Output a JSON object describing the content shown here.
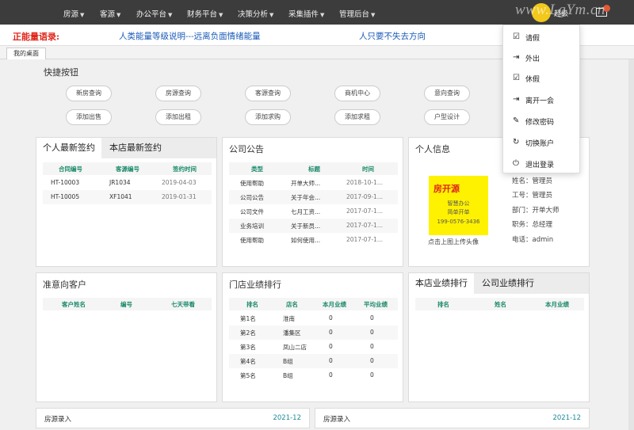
{
  "nav": {
    "items": [
      {
        "label": "房源"
      },
      {
        "label": "客源"
      },
      {
        "label": "办公平台"
      },
      {
        "label": "财务平台"
      },
      {
        "label": "决策分析"
      },
      {
        "label": "采集插件"
      },
      {
        "label": "管理后台"
      }
    ],
    "user_label": "超级",
    "watermark": "www.LgYm.cn"
  },
  "motto": {
    "label": "正能量语录:",
    "line1": "人类能量等级说明---远离负面情绪能量",
    "line2": "人只要不失去方向"
  },
  "tabs": {
    "home": "我的桌面"
  },
  "quick": {
    "title": "快捷按钮",
    "buttons": [
      "新房查询",
      "房源查询",
      "客源查询",
      "商机中心",
      "意向查询",
      "添加出售",
      "添加出租",
      "添加求购",
      "添加求租",
      "户型设计"
    ]
  },
  "sign": {
    "tabs": [
      "个人最新签约",
      "本店最新签约"
    ],
    "headers": [
      "合同编号",
      "客源编号",
      "签约时间"
    ],
    "rows": [
      [
        "HT-10003",
        "JR1034",
        "2019-04-03"
      ],
      [
        "HT-10005",
        "XF1041",
        "2019-01-31"
      ]
    ]
  },
  "notice": {
    "title": "公司公告",
    "headers": [
      "类型",
      "标题",
      "时间"
    ],
    "rows": [
      [
        "使用帮助",
        "开单大师...",
        "2018-10-1..."
      ],
      [
        "公司公告",
        "关于年会...",
        "2017-09-1..."
      ],
      [
        "公司文件",
        "七月工资...",
        "2017-07-1..."
      ],
      [
        "业务培训",
        "关于新员...",
        "2017-07-1..."
      ],
      [
        "使用帮助",
        "如何使用...",
        "2017-07-1..."
      ]
    ]
  },
  "profile": {
    "title": "个人信息",
    "logo": "房开源",
    "img_lines": [
      "智慧办公",
      "简单开单",
      "199-0576-3436"
    ],
    "caption": "点击上图上传头像",
    "lines": [
      "姓名：管理员",
      "工号：管理员",
      "部门：开单大师",
      "职务：总经理",
      "电话：admin"
    ]
  },
  "prospect": {
    "title": "准意向客户",
    "headers": [
      "客户姓名",
      "编号",
      "七天带看"
    ]
  },
  "shop_rank": {
    "title": "门店业绩排行",
    "headers": [
      "排名",
      "店名",
      "本月业绩",
      "平均业绩"
    ],
    "rows": [
      [
        "第1名",
        "淮南",
        "0",
        "0"
      ],
      [
        "第2名",
        "潘集区",
        "0",
        "0"
      ],
      [
        "第3名",
        "凤山二店",
        "0",
        "0"
      ],
      [
        "第4名",
        "B组",
        "0",
        "0"
      ],
      [
        "第5名",
        "B组",
        "0",
        "0"
      ]
    ]
  },
  "perf": {
    "tabs": [
      "本店业绩排行",
      "公司业绩排行"
    ],
    "headers": [
      "排名",
      "姓名",
      "本月业绩"
    ]
  },
  "bottom": [
    {
      "label": "房源录入",
      "date": "2021-12"
    },
    {
      "label": "房源录入",
      "date": "2021-12"
    }
  ],
  "dropdown": {
    "items": [
      {
        "label": "请假",
        "icon": "edit-icon"
      },
      {
        "label": "外出",
        "icon": "out-icon"
      },
      {
        "label": "休假",
        "icon": "edit-icon"
      },
      {
        "label": "离开一会",
        "icon": "out-icon"
      },
      {
        "label": "修改密码",
        "icon": "pencil-icon"
      },
      {
        "label": "切换账户",
        "icon": "refresh-icon"
      },
      {
        "label": "退出登录",
        "icon": "power-icon"
      }
    ]
  },
  "colors": {
    "nav_bg": "#3c3c3c",
    "accent_green": "#1a8a6a",
    "motto_red": "#e0261b",
    "motto_blue": "#1a5ab8"
  }
}
